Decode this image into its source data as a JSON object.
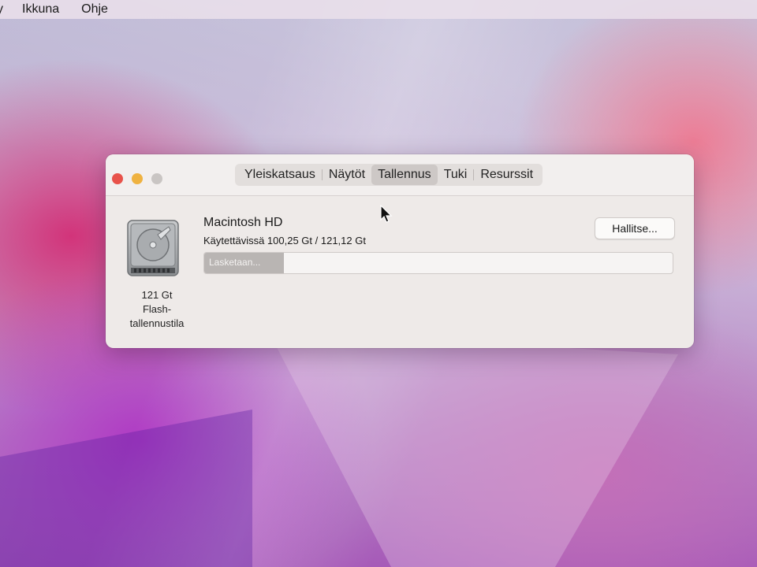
{
  "menubar": {
    "items": [
      "y",
      "Ikkuna",
      "Ohje"
    ]
  },
  "window": {
    "tabs": [
      {
        "label": "Yleiskatsaus",
        "active": false
      },
      {
        "label": "Näytöt",
        "active": false
      },
      {
        "label": "Tallennus",
        "active": true
      },
      {
        "label": "Tuki",
        "active": false
      },
      {
        "label": "Resurssit",
        "active": false
      }
    ],
    "disk": {
      "icon": "hard-drive-icon",
      "caption_line1": "121 Gt",
      "caption_line2": "Flash-",
      "caption_line3": "tallennustila"
    },
    "volume": {
      "name": "Macintosh HD",
      "available": "Käytettävissä 100,25 Gt / 121,12 Gt",
      "bar_label": "Lasketaan...",
      "bar_progress": 0.17
    },
    "manage_button": "Hallitse..."
  },
  "colors": {
    "close": "#e8524a",
    "minimize": "#efb240",
    "zoom_disabled": "#c9c5c3"
  }
}
